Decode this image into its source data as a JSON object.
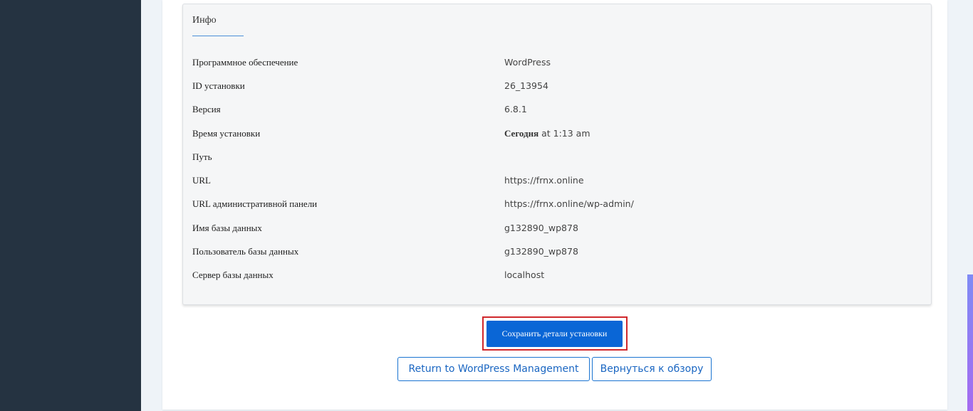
{
  "info": {
    "title": "Инфо",
    "rows": [
      {
        "label": "Программное обеспечение",
        "value": "WordPress"
      },
      {
        "label": "ID установки",
        "value": "26_13954"
      },
      {
        "label": "Версия",
        "value": "6.8.1"
      },
      {
        "label": "Время установки",
        "value_bold": "Сегодня",
        "value": "at 1:13 am"
      },
      {
        "label": "Путь",
        "value": ""
      },
      {
        "label": "URL",
        "value": "https://frnx.online"
      },
      {
        "label": "URL административной панели",
        "value": "https://frnx.online/wp-admin/"
      },
      {
        "label": "Имя базы данных",
        "value": "g132890_wp878"
      },
      {
        "label": "Пользователь базы данных",
        "value": "g132890_wp878"
      },
      {
        "label": "Сервер базы данных",
        "value": "localhost"
      }
    ]
  },
  "actions": {
    "save_label": "Сохранить детали установки",
    "return_label": "Return to WordPress Management",
    "overview_label": "Вернуться к обзору"
  },
  "colors": {
    "sidebar": "#253341",
    "primary": "#0a66d6",
    "highlight": "#d0282c",
    "accent_line": "#4b8fd8"
  }
}
